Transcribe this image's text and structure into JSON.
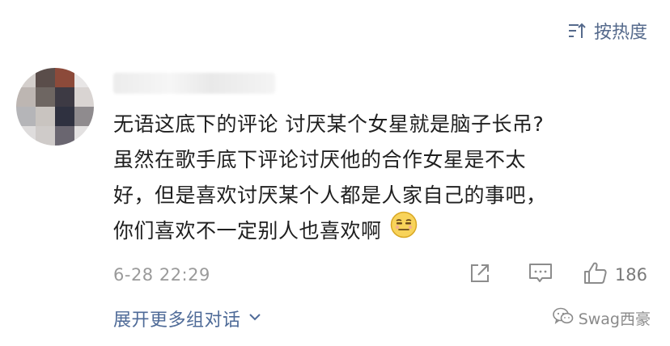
{
  "sort": {
    "label": "按热度",
    "icon": "sort-icon"
  },
  "comment": {
    "lines": [
      "无语这底下的评论 讨厌某个女星就是脑子长吊?",
      "虽然在歌手底下评论讨厌他的合作女星是不太",
      "好，但是喜欢讨厌某个人都是人家自己的事吧，",
      "你们喜欢不一定别人也喜欢啊"
    ],
    "emoji": "awkward-smile-emoji",
    "timestamp": "6-28 22:29",
    "like_count": "186"
  },
  "thread": {
    "expand_label": "展开更多组对话",
    "expand_icon": "chevron-down-icon"
  },
  "watermark": {
    "text": "Swag西豪",
    "icon": "wechat-icon"
  },
  "colors": {
    "link_blue": "#4f6b98",
    "meta_gray": "#9a9a9a",
    "text": "#1f1f1f"
  }
}
